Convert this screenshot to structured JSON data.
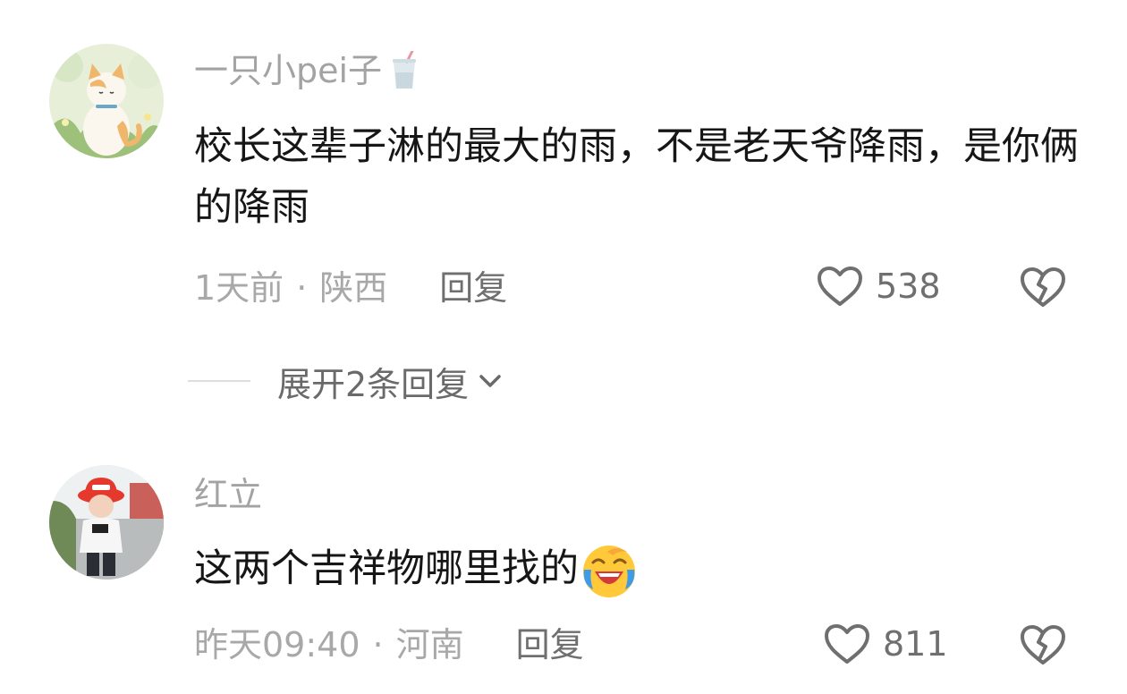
{
  "comments": [
    {
      "username": "一只小pei子",
      "username_icon": "cup-icon",
      "text": "校长这辈子淋的最大的雨，不是老天爷降雨，是你俩的降雨",
      "time": "1天前",
      "separator": "·",
      "location": "陕西",
      "reply_label": "回复",
      "likes": "538",
      "avatar": "cat-avatar",
      "expand_label": "展开2条回复"
    },
    {
      "username": "红立",
      "text": "这两个吉祥物哪里找的",
      "text_emoji": "laughing-crying-emoji",
      "time": "昨天09:40",
      "separator": "·",
      "location": "河南",
      "reply_label": "回复",
      "likes": "811",
      "avatar": "child-avatar"
    }
  ],
  "colors": {
    "text_primary": "#161616",
    "text_secondary": "#a8a8a8",
    "text_action": "#6f6f6f"
  }
}
